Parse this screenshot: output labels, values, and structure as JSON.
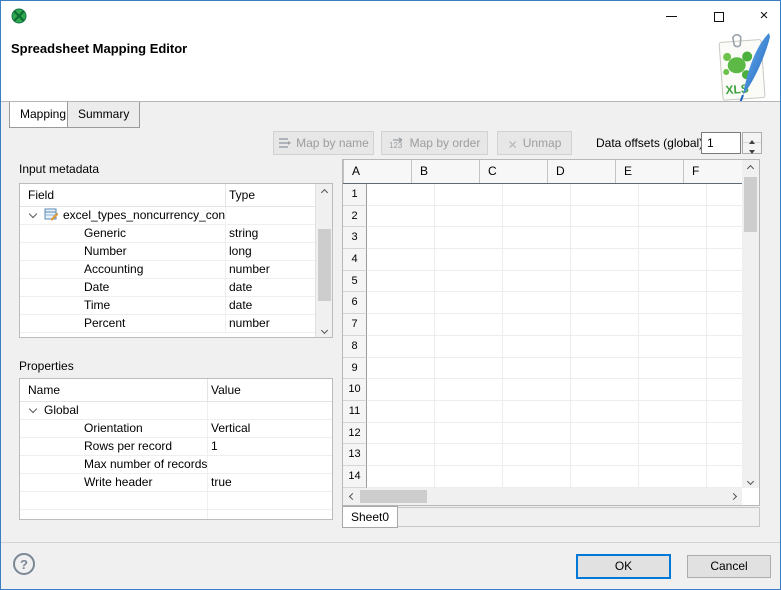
{
  "window": {
    "app_icon": "clover-green-ball",
    "controls": {
      "minimize": "minimize",
      "maximize": "maximize",
      "close": "×"
    }
  },
  "header": {
    "title": "Spreadsheet Mapping Editor",
    "file_badge": "XLS"
  },
  "tabs": [
    {
      "label": "Mapping",
      "active": true
    },
    {
      "label": "Summary",
      "active": false
    }
  ],
  "toolbar": {
    "map_by_name": "Map by name",
    "map_by_order": "Map by order",
    "map_by_order_icon_text": "123",
    "unmap": "Unmap",
    "unmap_icon": "✕",
    "data_offsets_label": "Data offsets (global)",
    "data_offsets_value": "1"
  },
  "input_metadata": {
    "label": "Input metadata",
    "columns": {
      "field": "Field",
      "type": "Type"
    },
    "root": "excel_types_noncurrency_con",
    "rows": [
      {
        "field": "Generic",
        "type": "string"
      },
      {
        "field": "Number",
        "type": "long"
      },
      {
        "field": "Accounting",
        "type": "number"
      },
      {
        "field": "Date",
        "type": "date"
      },
      {
        "field": "Time",
        "type": "date"
      },
      {
        "field": "Percent",
        "type": "number"
      }
    ]
  },
  "properties": {
    "label": "Properties",
    "columns": {
      "name": "Name",
      "value": "Value"
    },
    "root": "Global",
    "rows": [
      {
        "name": "Orientation",
        "value": "Vertical"
      },
      {
        "name": "Rows per record",
        "value": "1"
      },
      {
        "name": "Max number of records",
        "value": ""
      },
      {
        "name": "Write header",
        "value": "true"
      }
    ]
  },
  "spreadsheet": {
    "columns": [
      "A",
      "B",
      "C",
      "D",
      "E",
      "F"
    ],
    "row_labels": [
      "1",
      "2",
      "3",
      "4",
      "5",
      "6",
      "7",
      "8",
      "9",
      "10",
      "11",
      "12",
      "13",
      "14"
    ],
    "sheet_tab": "Sheet0"
  },
  "footer": {
    "help": "?",
    "ok": "OK",
    "cancel": "Cancel"
  },
  "colors": {
    "window_border": "#3a7dc2",
    "accent": "#0078d7",
    "titlebar_bg": "#ffffff",
    "body_bg": "#f0f0f0",
    "logo_green": "#2fa84f",
    "xls_text_green": "#3fa33f",
    "feather_blue": "#2f7fd6"
  }
}
